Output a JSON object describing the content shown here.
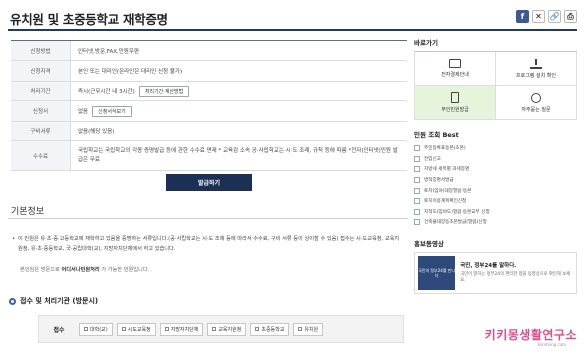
{
  "header": {
    "title": "유치원 및 초중등학교 재학증명",
    "share_icons": [
      "facebook-icon",
      "x-icon",
      "link-icon",
      "print-icon"
    ]
  },
  "info": {
    "rows": [
      {
        "label": "신청방법",
        "value": "인터넷,방문,FAX,민원우편"
      },
      {
        "label": "신청자격",
        "value": "본인 또는 대리인(온라인은 대리인 신청 불가)"
      },
      {
        "label": "처리기간",
        "value": "즉시(근무시간 내 3시간)",
        "button": "처리기간 계산방법"
      },
      {
        "label": "신청서",
        "value": "없음",
        "button": "신청서식보기"
      },
      {
        "label": "구비서류",
        "value": "없음(해당 있음)"
      },
      {
        "label": "수수료",
        "value": "국립학교는 국립학교의 각종 증명발급 등에 관한 수수료 면제 * 교육감 소속 공·사립학교는 시·도 조례, 규칙 등에 따름 *전자(인터넷)민원 발급은 무료"
      }
    ],
    "issue_button": "발급하기"
  },
  "basic": {
    "title": "기본정보",
    "text": "이 민원은 유·초·중·고등학교에 재학하고 있음을 증명하는 서류입니다.(공·사립학교는 시·도 조례 등에 따라서 수수료, 구비 서류 등이 상이할 수 있음) 접수는 시·도교육청, 교육지원청, 유·초·중등학교, 국·공립대학(교), 지방자치단체에서 하고 있습니다.",
    "note_prefix": "본인임은 방문으로",
    "note_bold": "어디서나민원처리",
    "note_suffix": "가 가능한 민원입니다."
  },
  "process": {
    "title": "접수 및 처리기관 (방문시)",
    "label": "접수",
    "items": [
      "대학(교)",
      "시도교육청",
      "지방자치단체",
      "교육지원청",
      "초중등학교",
      "유치원"
    ]
  },
  "sidebar": {
    "quick_title": "바로가기",
    "quick_items": [
      {
        "label": "전자결제안내",
        "icon": "payment-icon",
        "highlight": false
      },
      {
        "label": "프로그램 설치 확인",
        "icon": "download-icon",
        "highlight": false
      },
      {
        "label": "무인민원발급",
        "icon": "kiosk-icon",
        "highlight": true
      },
      {
        "label": "자주묻는 질문",
        "icon": "question-icon",
        "highlight": false
      }
    ],
    "best_title": "민원 조회 Best",
    "best_items": [
      "주민등록표등본(초본)",
      "전입신고",
      "지방세 세목별 과세증명",
      "병적증명서발급",
      "토지(임야)대장열람·등본",
      "토지이용계획확인신청",
      "지적도(임야도)열람·등본교부 신청",
      "건축물대장등초본발급(열람)신청"
    ],
    "promo_title": "홍보동영상",
    "promo_thumb": "국민의 정부24를 만나다",
    "promo_heading": "국민, 정부24를 말하다.",
    "promo_desc": "국민이 말하는 정부24의 편리한 점을 동영상으로 확인해 보세요."
  },
  "watermark": {
    "text": "키키몽생활연구소",
    "sub": "kikimong.com"
  }
}
